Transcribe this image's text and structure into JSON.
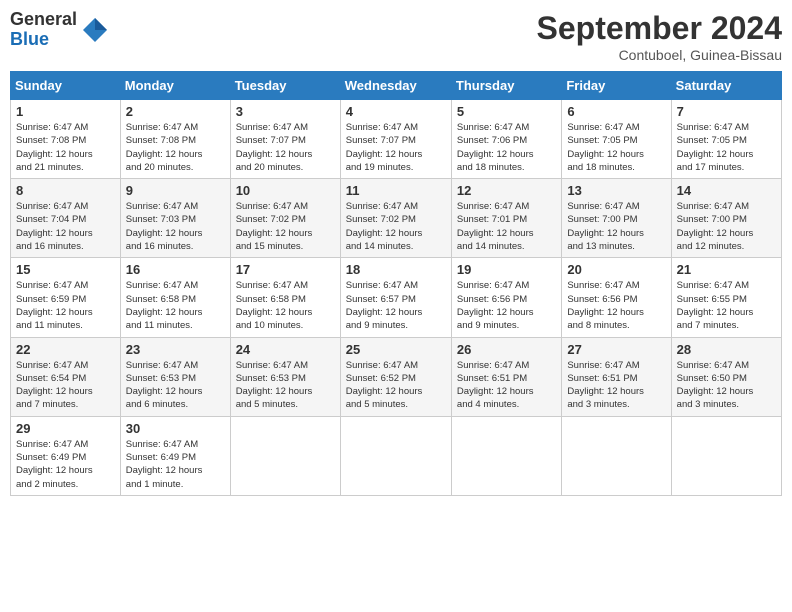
{
  "header": {
    "logo_general": "General",
    "logo_blue": "Blue",
    "month_title": "September 2024",
    "location": "Contuboel, Guinea-Bissau"
  },
  "weekdays": [
    "Sunday",
    "Monday",
    "Tuesday",
    "Wednesday",
    "Thursday",
    "Friday",
    "Saturday"
  ],
  "weeks": [
    [
      {
        "day": "1",
        "info": "Sunrise: 6:47 AM\nSunset: 7:08 PM\nDaylight: 12 hours\nand 21 minutes."
      },
      {
        "day": "2",
        "info": "Sunrise: 6:47 AM\nSunset: 7:08 PM\nDaylight: 12 hours\nand 20 minutes."
      },
      {
        "day": "3",
        "info": "Sunrise: 6:47 AM\nSunset: 7:07 PM\nDaylight: 12 hours\nand 20 minutes."
      },
      {
        "day": "4",
        "info": "Sunrise: 6:47 AM\nSunset: 7:07 PM\nDaylight: 12 hours\nand 19 minutes."
      },
      {
        "day": "5",
        "info": "Sunrise: 6:47 AM\nSunset: 7:06 PM\nDaylight: 12 hours\nand 18 minutes."
      },
      {
        "day": "6",
        "info": "Sunrise: 6:47 AM\nSunset: 7:05 PM\nDaylight: 12 hours\nand 18 minutes."
      },
      {
        "day": "7",
        "info": "Sunrise: 6:47 AM\nSunset: 7:05 PM\nDaylight: 12 hours\nand 17 minutes."
      }
    ],
    [
      {
        "day": "8",
        "info": "Sunrise: 6:47 AM\nSunset: 7:04 PM\nDaylight: 12 hours\nand 16 minutes."
      },
      {
        "day": "9",
        "info": "Sunrise: 6:47 AM\nSunset: 7:03 PM\nDaylight: 12 hours\nand 16 minutes."
      },
      {
        "day": "10",
        "info": "Sunrise: 6:47 AM\nSunset: 7:02 PM\nDaylight: 12 hours\nand 15 minutes."
      },
      {
        "day": "11",
        "info": "Sunrise: 6:47 AM\nSunset: 7:02 PM\nDaylight: 12 hours\nand 14 minutes."
      },
      {
        "day": "12",
        "info": "Sunrise: 6:47 AM\nSunset: 7:01 PM\nDaylight: 12 hours\nand 14 minutes."
      },
      {
        "day": "13",
        "info": "Sunrise: 6:47 AM\nSunset: 7:00 PM\nDaylight: 12 hours\nand 13 minutes."
      },
      {
        "day": "14",
        "info": "Sunrise: 6:47 AM\nSunset: 7:00 PM\nDaylight: 12 hours\nand 12 minutes."
      }
    ],
    [
      {
        "day": "15",
        "info": "Sunrise: 6:47 AM\nSunset: 6:59 PM\nDaylight: 12 hours\nand 11 minutes."
      },
      {
        "day": "16",
        "info": "Sunrise: 6:47 AM\nSunset: 6:58 PM\nDaylight: 12 hours\nand 11 minutes."
      },
      {
        "day": "17",
        "info": "Sunrise: 6:47 AM\nSunset: 6:58 PM\nDaylight: 12 hours\nand 10 minutes."
      },
      {
        "day": "18",
        "info": "Sunrise: 6:47 AM\nSunset: 6:57 PM\nDaylight: 12 hours\nand 9 minutes."
      },
      {
        "day": "19",
        "info": "Sunrise: 6:47 AM\nSunset: 6:56 PM\nDaylight: 12 hours\nand 9 minutes."
      },
      {
        "day": "20",
        "info": "Sunrise: 6:47 AM\nSunset: 6:56 PM\nDaylight: 12 hours\nand 8 minutes."
      },
      {
        "day": "21",
        "info": "Sunrise: 6:47 AM\nSunset: 6:55 PM\nDaylight: 12 hours\nand 7 minutes."
      }
    ],
    [
      {
        "day": "22",
        "info": "Sunrise: 6:47 AM\nSunset: 6:54 PM\nDaylight: 12 hours\nand 7 minutes."
      },
      {
        "day": "23",
        "info": "Sunrise: 6:47 AM\nSunset: 6:53 PM\nDaylight: 12 hours\nand 6 minutes."
      },
      {
        "day": "24",
        "info": "Sunrise: 6:47 AM\nSunset: 6:53 PM\nDaylight: 12 hours\nand 5 minutes."
      },
      {
        "day": "25",
        "info": "Sunrise: 6:47 AM\nSunset: 6:52 PM\nDaylight: 12 hours\nand 5 minutes."
      },
      {
        "day": "26",
        "info": "Sunrise: 6:47 AM\nSunset: 6:51 PM\nDaylight: 12 hours\nand 4 minutes."
      },
      {
        "day": "27",
        "info": "Sunrise: 6:47 AM\nSunset: 6:51 PM\nDaylight: 12 hours\nand 3 minutes."
      },
      {
        "day": "28",
        "info": "Sunrise: 6:47 AM\nSunset: 6:50 PM\nDaylight: 12 hours\nand 3 minutes."
      }
    ],
    [
      {
        "day": "29",
        "info": "Sunrise: 6:47 AM\nSunset: 6:49 PM\nDaylight: 12 hours\nand 2 minutes."
      },
      {
        "day": "30",
        "info": "Sunrise: 6:47 AM\nSunset: 6:49 PM\nDaylight: 12 hours\nand 1 minute."
      },
      {
        "day": "",
        "info": ""
      },
      {
        "day": "",
        "info": ""
      },
      {
        "day": "",
        "info": ""
      },
      {
        "day": "",
        "info": ""
      },
      {
        "day": "",
        "info": ""
      }
    ]
  ]
}
